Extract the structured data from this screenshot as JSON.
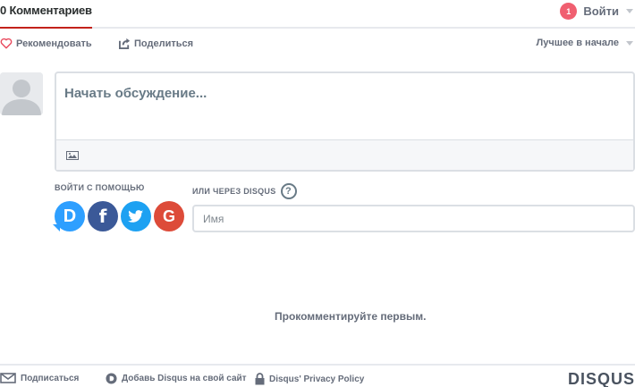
{
  "header": {
    "comments_tab": "0 Комментариев",
    "notification_count": "1",
    "login_label": "Войти"
  },
  "actions": {
    "recommend": "Рекомендовать",
    "share": "Поделиться",
    "sort": "Лучшее в начале"
  },
  "composer": {
    "placeholder": "Начать обсуждение..."
  },
  "auth": {
    "login_with_label": "ВОЙТИ С ПОМОЩЬЮ",
    "services": [
      {
        "name": "Disqus",
        "glyph": "D",
        "color": "#2e9fff"
      },
      {
        "name": "Facebook",
        "glyph": "f",
        "color": "#3b5998"
      },
      {
        "name": "Twitter",
        "glyph": "twitter-bird",
        "color": "#1da1f2"
      },
      {
        "name": "Google",
        "glyph": "G",
        "color": "#dd4b39"
      }
    ],
    "guest_label": "ИЛИ ЧЕРЕЗ DISQUS",
    "help_glyph": "?",
    "name_placeholder": "Имя"
  },
  "empty_state": "Прокомментируйте первым.",
  "footer": {
    "subscribe": "Подписаться",
    "add_disqus": "Добавь Disqus на свой сайт",
    "privacy": "Disqus' Privacy Policy",
    "brand": "DISQUS"
  },
  "colors": {
    "accent_underline": "#c3221b",
    "badge": "#f05f70"
  }
}
